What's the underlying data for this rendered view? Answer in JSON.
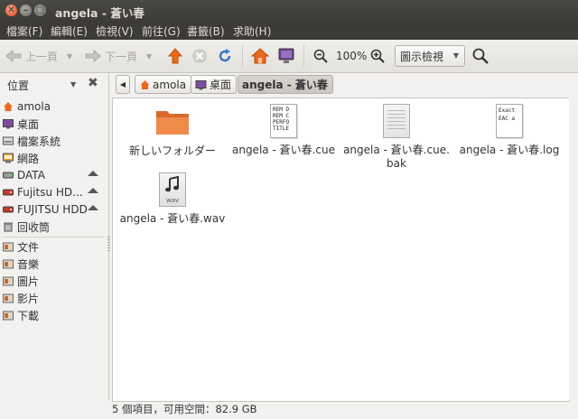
{
  "window": {
    "title": "angela - 蒼い春"
  },
  "menubar": {
    "items": [
      "檔案(F)",
      "編輯(E)",
      "檢視(V)",
      "前往(G)",
      "書籤(B)",
      "求助(H)"
    ]
  },
  "toolbar": {
    "back_label": "上一頁",
    "forward_label": "下一頁",
    "zoom_value": "100%",
    "view_mode": "圖示檢視"
  },
  "sidebar": {
    "header_label": "位置",
    "items": [
      {
        "label": "amola",
        "icon": "home-folder-icon"
      },
      {
        "label": "桌面",
        "icon": "desktop-icon"
      },
      {
        "label": "檔案系統",
        "icon": "filesystem-icon"
      },
      {
        "label": "網路",
        "icon": "network-icon"
      },
      {
        "label": "DATA",
        "icon": "drive-icon",
        "eject": true
      },
      {
        "label": "Fujitsu HD...",
        "icon": "drive-icon",
        "eject": true
      },
      {
        "label": "FUJITSU HDD",
        "icon": "drive-icon",
        "eject": true
      },
      {
        "label": "回收筒",
        "icon": "trash-icon"
      },
      {
        "label": "文件",
        "icon": "bookmark-folder-icon"
      },
      {
        "label": "音樂",
        "icon": "bookmark-folder-icon"
      },
      {
        "label": "圖片",
        "icon": "bookmark-folder-icon"
      },
      {
        "label": "影片",
        "icon": "bookmark-folder-icon"
      },
      {
        "label": "下載",
        "icon": "bookmark-folder-icon"
      }
    ]
  },
  "breadcrumbs": [
    "amola",
    "桌面",
    "angela - 蒼い春"
  ],
  "files": [
    {
      "name": "新しいフォルダー",
      "type": "folder"
    },
    {
      "name": "angela - 蒼い春.cue",
      "type": "cue",
      "preview": [
        "REM D",
        "REM C",
        "PERFO",
        "TITLE"
      ]
    },
    {
      "name_line1": "angela - 蒼い春.cue.",
      "name_line2": "bak",
      "type": "text"
    },
    {
      "name": "angela - 蒼い春.log",
      "type": "log",
      "preview": [
        "Exact",
        "EAC a"
      ]
    },
    {
      "name": "angela - 蒼い春.wav",
      "type": "audio",
      "badge": "wav"
    }
  ],
  "status": "5 個項目，可用空間：82.9 GB",
  "colors": {
    "accent": "#e2481c",
    "titlebar": "#3c3b37"
  }
}
